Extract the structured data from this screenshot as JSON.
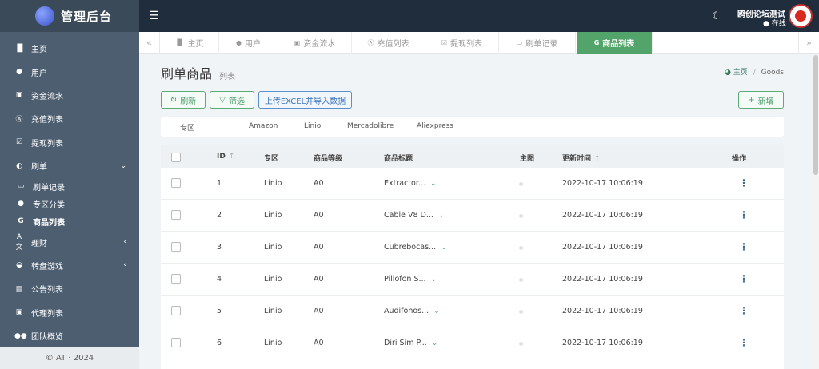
{
  "app": {
    "title": "管理后台"
  },
  "sidebar": {
    "items": [
      {
        "label": "主页",
        "icon": "bar-chart-icon"
      },
      {
        "label": "用户",
        "icon": "user-icon"
      },
      {
        "label": "资金流水",
        "icon": "money-icon"
      },
      {
        "label": "充值列表",
        "icon": "letter-a-icon"
      },
      {
        "label": "提现列表",
        "icon": "check-square-icon"
      },
      {
        "label": "刷单",
        "icon": "half-circle-icon"
      }
    ],
    "sub_items": [
      {
        "label": "刷单记录",
        "icon": "keyboard-icon"
      },
      {
        "label": "专区分类",
        "icon": "circle-icon"
      },
      {
        "label": "商品列表",
        "icon": "google-icon"
      }
    ],
    "items_after": [
      {
        "label": "理财",
        "icon": "language-icon"
      },
      {
        "label": "转盘游戏",
        "icon": "gamepad-icon"
      },
      {
        "label": "公告列表",
        "icon": "file-icon"
      },
      {
        "label": "代理列表",
        "icon": "contact-icon"
      },
      {
        "label": "团队概览",
        "icon": "users-icon"
      }
    ],
    "footer": "© AT · 2024"
  },
  "topbar": {
    "user_name": "鸥创论坛测试",
    "user_status": "在线"
  },
  "tabs": [
    {
      "label": "主页",
      "icon": "bar-chart-icon"
    },
    {
      "label": "用户",
      "icon": "user-icon"
    },
    {
      "label": "资金流水",
      "icon": "money-icon"
    },
    {
      "label": "充值列表",
      "icon": "letter-a-icon"
    },
    {
      "label": "提现列表",
      "icon": "check-square-icon"
    },
    {
      "label": "刷单记录",
      "icon": "keyboard-icon"
    },
    {
      "label": "商品列表",
      "icon": "google-icon",
      "active": true
    }
  ],
  "page": {
    "title": "刷单商品",
    "subtitle": "列表",
    "breadcrumb_home": "主页",
    "breadcrumb_sep": "/",
    "breadcrumb_current": "Goods"
  },
  "toolbar": {
    "refresh": "刷新",
    "filter": "筛选",
    "upload": "上传EXCEL并导入数据",
    "add": "新增"
  },
  "filter_bar": {
    "label": "专区",
    "options": [
      "Amazon",
      "Linio",
      "Mercadolibre",
      "Aliexpress"
    ]
  },
  "table": {
    "headers": [
      "ID",
      "专区",
      "商品等级",
      "商品标题",
      "主图",
      "更新时间",
      "操作"
    ],
    "rows": [
      {
        "id": "1",
        "zone": "Linio",
        "level": "A0",
        "title": "Extractor...",
        "updated": "2022-10-17 10:06:19"
      },
      {
        "id": "2",
        "zone": "Linio",
        "level": "A0",
        "title": "Cable V8 D...",
        "updated": "2022-10-17 10:06:19"
      },
      {
        "id": "3",
        "zone": "Linio",
        "level": "A0",
        "title": "Cubrebocas...",
        "updated": "2022-10-17 10:06:19"
      },
      {
        "id": "4",
        "zone": "Linio",
        "level": "A0",
        "title": "Pillofon S...",
        "updated": "2022-10-17 10:06:19"
      },
      {
        "id": "5",
        "zone": "Linio",
        "level": "A0",
        "title": "Audifonos...",
        "updated": "2022-10-17 10:06:19"
      },
      {
        "id": "6",
        "zone": "Linio",
        "level": "A0",
        "title": "Diri Sim P...",
        "updated": "2022-10-17 10:06:19"
      }
    ]
  }
}
